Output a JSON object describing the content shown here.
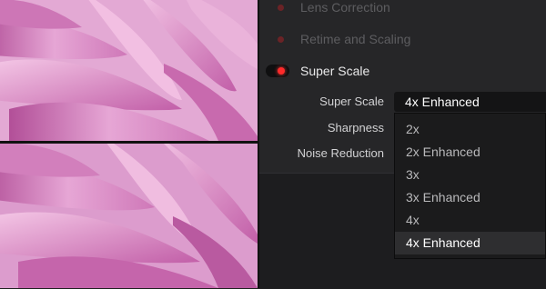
{
  "sections": [
    {
      "label": "Lens Correction",
      "enabled": false
    },
    {
      "label": "Retime and Scaling",
      "enabled": false
    },
    {
      "label": "Super Scale",
      "enabled": true
    }
  ],
  "params": {
    "super_scale_label": "Super Scale",
    "sharpness_label": "Sharpness",
    "noise_reduction_label": "Noise Reduction"
  },
  "super_scale_select": {
    "value": "4x Enhanced",
    "options": [
      "2x",
      "2x Enhanced",
      "3x",
      "3x Enhanced",
      "4x",
      "4x Enhanced"
    ],
    "selected_index": 5
  },
  "colors": {
    "active_toggle": "#ff2a2a",
    "panel_bg": "#262628",
    "petal_pink": "#d88fc4"
  },
  "icons": [
    "toggle-switch-icon",
    "disabled-dot-icon"
  ]
}
